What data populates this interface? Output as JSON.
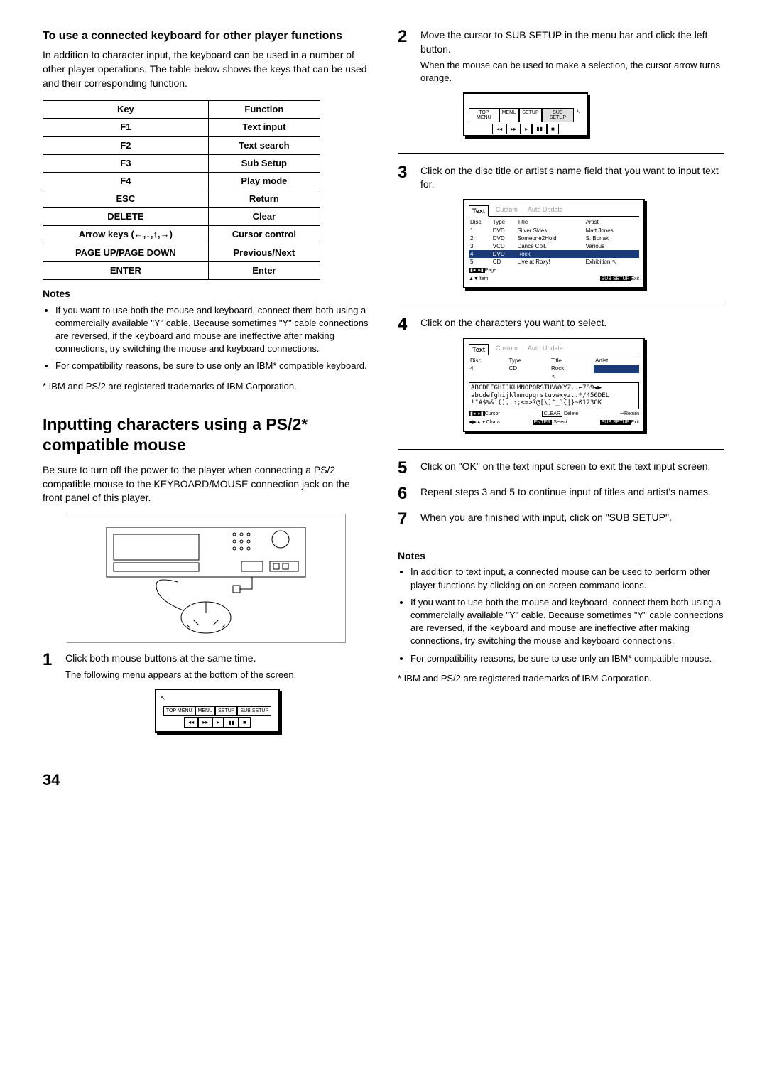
{
  "left": {
    "h_sub": "To use a connected keyboard for other player functions",
    "p1": "In addition to character input, the keyboard can be used in a number of other player operations. The table below shows the keys that can be used and their corresponding function.",
    "table": {
      "head": [
        "Key",
        "Function"
      ],
      "rows": [
        [
          "F1",
          "Text input"
        ],
        [
          "F2",
          "Text search"
        ],
        [
          "F3",
          "Sub Setup"
        ],
        [
          "F4",
          "Play mode"
        ],
        [
          "ESC",
          "Return"
        ],
        [
          "DELETE",
          "Clear"
        ],
        [
          "Arrow keys (←,↓,↑,→)",
          "Cursor control"
        ],
        [
          "PAGE UP/PAGE DOWN",
          "Previous/Next"
        ],
        [
          "ENTER",
          "Enter"
        ]
      ]
    },
    "notes_h": "Notes",
    "notes": [
      "If you want to use both the mouse and keyboard, connect them both using a commercially available \"Y\" cable. Because sometimes \"Y\" cable connections are reversed, if the keyboard and mouse are ineffective after making connections, try switching the mouse and keyboard connections.",
      "For compatibility reasons, be sure to use only an IBM* compatible keyboard."
    ],
    "foot": "* IBM and PS/2 are registered trademarks of IBM Corporation.",
    "h_main": "Inputting characters using a PS/2* compatible mouse",
    "p2": "Be sure to turn off the power to the player when connecting a PS/2 compatible mouse to the KEYBOARD/MOUSE connection jack on the front panel of this player.",
    "step1_main": "Click both mouse buttons at the same time.",
    "step1_sub": "The following menu appears at the bottom of the screen.",
    "menu_labels": [
      "TOP MENU",
      "MENU",
      "SETUP",
      "SUB SETUP"
    ]
  },
  "right": {
    "step2_main": "Move the cursor to SUB SETUP in the menu bar and click the left button.",
    "step2_sub": "When the mouse can be used to make a selection, the cursor arrow turns orange.",
    "step3_main": "Click on the disc title or artist's name field that you want to input text for.",
    "tabs": [
      "Text",
      "Custom",
      "Auto Update"
    ],
    "grid_head": [
      "Disc",
      "Type",
      "Title",
      "Artist"
    ],
    "grid_rows": [
      [
        "1",
        "DVD",
        "Silver Skies",
        "Matt Jones"
      ],
      [
        "2",
        "DVD",
        "Someone2Hold",
        "S. Bonak"
      ],
      [
        "3",
        "VCD",
        "Dance Coll.",
        "Various"
      ],
      [
        "4",
        "DVD",
        "Rock",
        ""
      ],
      [
        "5",
        "CD",
        "Live at Roxy!",
        "Exhibition"
      ]
    ],
    "statusbar3": {
      "page": "Page",
      "item": "Item",
      "subsetup": "SUB SETUP",
      "exit": "Exit"
    },
    "step4_main": "Click on the characters you want to select.",
    "grid4_row": [
      "4",
      "CD",
      "Rock",
      ""
    ],
    "chars": [
      "ABCDEFGHIJKLMNOPQRSTUVWXYZ..←789◀▶",
      "abcdefghijklmnopqrstuvwxyz..*/456DEL",
      "!\"#$%&'(),.:;<=>?@[\\]^_`{|}~0123OK"
    ],
    "statusbar4": {
      "cursor": "Cursor",
      "clear": "CLEAR",
      "delete": "Delete",
      "ret": "Return",
      "chara": "Chara",
      "enter": "ENTER",
      "select": "Select",
      "subsetup": "SUB SETUP",
      "exit": "Exit"
    },
    "step5_main": "Click on \"OK\" on the text input screen to exit the text input screen.",
    "step6_main": "Repeat steps 3 and 5 to continue input of titles and artist's names.",
    "step7_main": "When you are finished with input, click on \"SUB SETUP\".",
    "notes_h": "Notes",
    "notes": [
      "In addition to text input, a connected mouse can be used to perform other player functions by clicking on on-screen command icons.",
      "If you want to use both the mouse and keyboard, connect them both using a commercially available \"Y\" cable. Because sometimes \"Y\" cable connections are reversed, if the keyboard and mouse are ineffective after making connections, try switching the mouse and keyboard connections.",
      "For compatibility reasons, be sure to use only an IBM* compatible mouse."
    ],
    "foot": "* IBM and PS/2 are registered trademarks of IBM Corporation."
  },
  "pagenum": "34"
}
